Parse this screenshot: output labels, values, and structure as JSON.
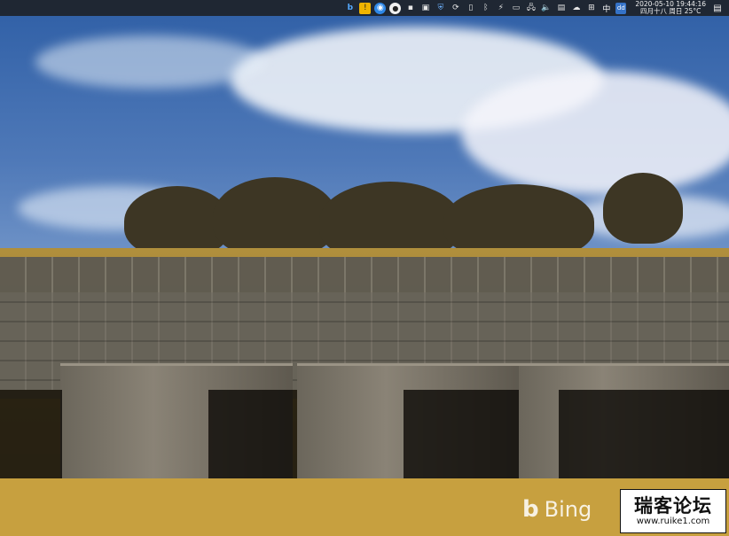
{
  "taskbar": {
    "tray_icons": [
      {
        "name": "bing-icon",
        "glyph": "b"
      },
      {
        "name": "notification-app-icon",
        "glyph": "!"
      },
      {
        "name": "browser-icon",
        "glyph": "◉"
      },
      {
        "name": "wechat-icon",
        "glyph": "●"
      },
      {
        "name": "app-icon",
        "glyph": "▪"
      },
      {
        "name": "window-icon",
        "glyph": "▣"
      },
      {
        "name": "security-shield-icon",
        "glyph": "⛨"
      },
      {
        "name": "sync-icon",
        "glyph": "⟳"
      },
      {
        "name": "usb-drive-icon",
        "glyph": "▯"
      },
      {
        "name": "bluetooth-icon",
        "glyph": "ᛒ"
      },
      {
        "name": "power-icon",
        "glyph": "⚡"
      },
      {
        "name": "battery-icon",
        "glyph": "▭"
      },
      {
        "name": "network-icon",
        "glyph": "🖧"
      },
      {
        "name": "volume-icon",
        "glyph": "🔈"
      },
      {
        "name": "storage-icon",
        "glyph": "▤"
      },
      {
        "name": "weather-icon",
        "glyph": "☁"
      },
      {
        "name": "windows-icon",
        "glyph": "⊞"
      },
      {
        "name": "input-language-icon",
        "glyph": "中"
      },
      {
        "name": "app-badge-icon",
        "glyph": "dd"
      }
    ],
    "clock": {
      "datetime": "2020-05-10 19:44:16",
      "lunar_weather": "四月十八 周日 25°C"
    },
    "notification_glyph": "▤"
  },
  "wallpaper": {
    "brand_logo_glyph": "b",
    "brand_text": "Bing"
  },
  "watermark": {
    "title": "瑞客论坛",
    "url": "www.ruike1.com"
  },
  "colors": {
    "taskbar_bg": "#1f2733",
    "watermark_bg": "#ffffff"
  }
}
